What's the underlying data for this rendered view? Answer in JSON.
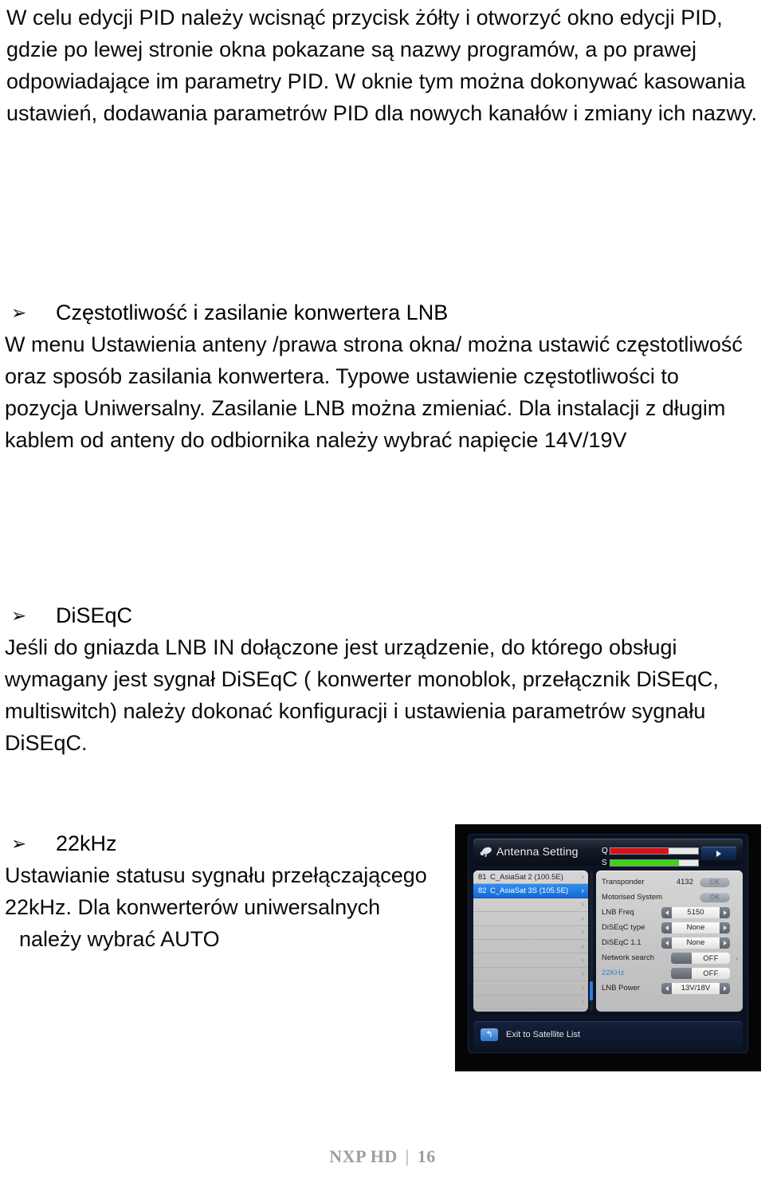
{
  "document": {
    "intro_paragraph": [
      "W celu edycji PID należy wcisnąć przycisk żółty i otworzyć okno edycji PID,",
      "gdzie po   lewej stronie okna pokazane są nazwy programów, a po prawej",
      " odpowiadające im parametry PID. W oknie tym można dokonywać kasowania",
      "ustawień, dodawania parametrów PID dla nowych kanałów i zmiany ich nazwy."
    ],
    "bullet_glyph": "➢",
    "sections": [
      {
        "heading": "Częstotliwość i zasilanie konwertera LNB",
        "lines": [
          "W menu Ustawienia anteny /prawa strona okna/ można ustawić częstotliwość",
          "oraz sposób zasilania konwertera. Typowe ustawienie częstotliwości to",
          "pozycja Uniwersalny. Zasilanie LNB można zmieniać. Dla instalacji z długim",
          "kablem od anteny do odbiornika należy wybrać napięcie 14V/19V"
        ]
      },
      {
        "heading": "DiSEqC",
        "lines": [
          "Jeśli do gniazda LNB IN dołączone jest urządzenie, do którego obsługi",
          " wymagany jest sygnał DiSEqC ( konwerter monoblok, przełącznik DiSEqC,",
          "multiswitch) należy dokonać konfiguracji i ustawienia parametrów sygnału",
          "DiSEqC."
        ]
      },
      {
        "heading": "22kHz",
        "lines": [
          "Ustawianie statusu sygnału przełączającego",
          "22kHz.  Dla  konwerterów  uniwersalnych",
          "należy wybrać AUTO"
        ]
      }
    ],
    "footer": {
      "brand": "NXP HD",
      "separator": "|",
      "page_number": "16"
    }
  },
  "stb_screenshot": {
    "title": "Antenna Setting",
    "signal": {
      "quality_label": "Q",
      "quality_percent": 66,
      "strength_label": "S",
      "strength_percent": 78,
      "quality_color": "#d61214",
      "strength_color": "#3fd215"
    },
    "next_button": "▶",
    "satellite_list": [
      {
        "index": "81",
        "name": "C_AsiaSat 2 (100.5E)",
        "selected": false,
        "chevron": "›"
      },
      {
        "index": "82",
        "name": "C_AsiaSat 3S  (105.5E)",
        "selected": true,
        "chevron": "›"
      },
      {
        "index": "",
        "name": "",
        "selected": false,
        "chevron": "›"
      },
      {
        "index": "",
        "name": "",
        "selected": false,
        "chevron": "›"
      },
      {
        "index": "",
        "name": "",
        "selected": false,
        "chevron": "›"
      },
      {
        "index": "",
        "name": "",
        "selected": false,
        "chevron": "›"
      },
      {
        "index": "",
        "name": "",
        "selected": false,
        "chevron": "›"
      },
      {
        "index": "",
        "name": "",
        "selected": false,
        "chevron": "›"
      },
      {
        "index": "",
        "name": "",
        "selected": false,
        "chevron": "›"
      },
      {
        "index": "",
        "name": "",
        "selected": false,
        "chevron": "›"
      }
    ],
    "settings": [
      {
        "label": "Transponder",
        "value": "4132",
        "control": "ok",
        "button": "OK",
        "highlight": false,
        "chevron": ""
      },
      {
        "label": "Motorised System",
        "value": "",
        "control": "ok",
        "button": "OK",
        "highlight": false,
        "chevron": ""
      },
      {
        "label": "LNB Freq",
        "value": "5150",
        "control": "spinner",
        "button": "",
        "highlight": false,
        "chevron": ""
      },
      {
        "label": "DiSEqC type",
        "value": "None",
        "control": "spinner",
        "button": "",
        "highlight": false,
        "chevron": ""
      },
      {
        "label": "DiSEqC 1.1",
        "value": "None",
        "control": "spinner",
        "button": "",
        "highlight": false,
        "chevron": ""
      },
      {
        "label": "Network search",
        "value": "OFF",
        "control": "toggle",
        "button": "",
        "highlight": false,
        "chevron": "›"
      },
      {
        "label": "22KHz",
        "value": "OFF",
        "control": "toggle",
        "button": "",
        "highlight": true,
        "chevron": ""
      },
      {
        "label": "LNB Power",
        "value": "13V/18V",
        "control": "spinner",
        "button": "",
        "highlight": false,
        "chevron": ""
      }
    ],
    "exit_label": "Exit to Satellite List",
    "back_glyph": "↰"
  }
}
